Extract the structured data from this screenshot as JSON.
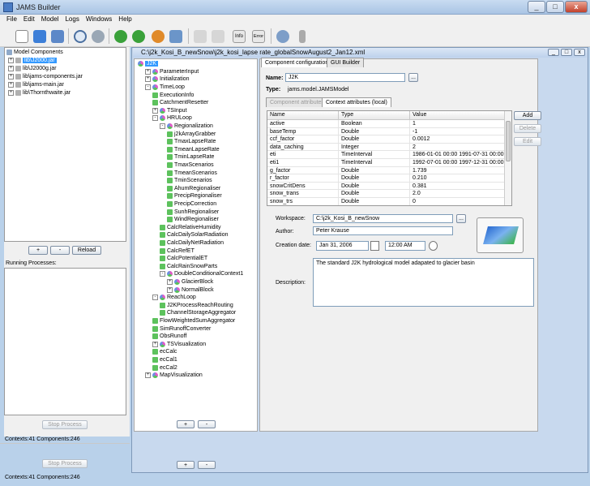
{
  "window": {
    "title": "JAMS Builder",
    "min": "_",
    "max": "□",
    "close": "x"
  },
  "menu": [
    "File",
    "Edit",
    "Model",
    "Logs",
    "Windows",
    "Help"
  ],
  "toolbar": {
    "info_label": "Info",
    "error_label": "Error"
  },
  "left": {
    "header": "Model Components",
    "jars": [
      "lib\\J2000.jar",
      "lib\\J2000g.jar",
      "lib\\jams-components.jar",
      "lib\\jams-main.jar",
      "lib\\Thornthwaite.jar"
    ],
    "add": "+",
    "remove": "-",
    "reload": "Reload",
    "running_header": "Running Processes:",
    "stop_label": "Stop Process",
    "status": "Contexts:41 Components:246"
  },
  "bottom": {
    "stop_label": "Stop Process",
    "status": "Contexts:41 Components:246"
  },
  "internal": {
    "title": "C:\\j2k_Kosi_B_newSnow\\j2k_kosi_lapse rate_globalSnowAugust2_Jan12.xml",
    "tree": [
      {
        "label": "J2K",
        "level": 0,
        "exp": "",
        "icon": "ctx"
      },
      {
        "label": "ParameterInput",
        "level": 1,
        "exp": "+",
        "icon": "ctx"
      },
      {
        "label": "Initialization",
        "level": 1,
        "exp": "+",
        "icon": "ctx"
      },
      {
        "label": "TimeLoop",
        "level": 1,
        "exp": "-",
        "icon": "ctx"
      },
      {
        "label": "ExecutionInfo",
        "level": 2,
        "exp": "",
        "icon": "comp"
      },
      {
        "label": "CatchmentResetter",
        "level": 2,
        "exp": "",
        "icon": "comp"
      },
      {
        "label": "TSInput",
        "level": 2,
        "exp": "+",
        "icon": "ctx"
      },
      {
        "label": "HRULoop",
        "level": 2,
        "exp": "-",
        "icon": "ctx"
      },
      {
        "label": "Regionalization",
        "level": 3,
        "exp": "-",
        "icon": "ctx"
      },
      {
        "label": "j2kArrayGrabber",
        "level": 4,
        "exp": "",
        "icon": "comp"
      },
      {
        "label": "TmaxLapseRate",
        "level": 4,
        "exp": "",
        "icon": "comp"
      },
      {
        "label": "TmeanLapseRate",
        "level": 4,
        "exp": "",
        "icon": "comp"
      },
      {
        "label": "TminLapseRate",
        "level": 4,
        "exp": "",
        "icon": "comp"
      },
      {
        "label": "TmaxScenarios",
        "level": 4,
        "exp": "",
        "icon": "comp"
      },
      {
        "label": "TmeanScenarios",
        "level": 4,
        "exp": "",
        "icon": "comp"
      },
      {
        "label": "TminScenarios",
        "level": 4,
        "exp": "",
        "icon": "comp"
      },
      {
        "label": "AhumRegionaliser",
        "level": 4,
        "exp": "",
        "icon": "comp"
      },
      {
        "label": "PrecipRegionaliser",
        "level": 4,
        "exp": "",
        "icon": "comp"
      },
      {
        "label": "PrecipCorrection",
        "level": 4,
        "exp": "",
        "icon": "comp"
      },
      {
        "label": "SunhRegionaliser",
        "level": 4,
        "exp": "",
        "icon": "comp"
      },
      {
        "label": "WindRegionaliser",
        "level": 4,
        "exp": "",
        "icon": "comp"
      },
      {
        "label": "CalcRelativeHumidity",
        "level": 3,
        "exp": "",
        "icon": "comp"
      },
      {
        "label": "CalcDailySolarRadiation",
        "level": 3,
        "exp": "",
        "icon": "comp"
      },
      {
        "label": "CalcDailyNetRadiation",
        "level": 3,
        "exp": "",
        "icon": "comp"
      },
      {
        "label": "CalcRefET",
        "level": 3,
        "exp": "",
        "icon": "comp"
      },
      {
        "label": "CalcPotentialET",
        "level": 3,
        "exp": "",
        "icon": "comp"
      },
      {
        "label": "CalcRainSnowParts",
        "level": 3,
        "exp": "",
        "icon": "comp"
      },
      {
        "label": "DoubleConditionalContext1",
        "level": 3,
        "exp": "-",
        "icon": "ctx"
      },
      {
        "label": "GlacierBlock",
        "level": 4,
        "exp": "+",
        "icon": "ctx"
      },
      {
        "label": "NormalBlock",
        "level": 4,
        "exp": "+",
        "icon": "ctx"
      },
      {
        "label": "ReachLoop",
        "level": 2,
        "exp": "-",
        "icon": "ctx"
      },
      {
        "label": "J2KProcessReachRouting",
        "level": 3,
        "exp": "",
        "icon": "comp"
      },
      {
        "label": "ChannelStorageAggregator",
        "level": 3,
        "exp": "",
        "icon": "comp"
      },
      {
        "label": "FlowWeightedSumAggregator",
        "level": 2,
        "exp": "",
        "icon": "comp"
      },
      {
        "label": "SimRunoffConverter",
        "level": 2,
        "exp": "",
        "icon": "comp"
      },
      {
        "label": "ObsRunoff",
        "level": 2,
        "exp": "",
        "icon": "comp"
      },
      {
        "label": "TSVisualization",
        "level": 2,
        "exp": "+",
        "icon": "ctx"
      },
      {
        "label": "ecCalc",
        "level": 2,
        "exp": "",
        "icon": "comp"
      },
      {
        "label": "ecCal1",
        "level": 2,
        "exp": "",
        "icon": "comp"
      },
      {
        "label": "ecCal2",
        "level": 2,
        "exp": "",
        "icon": "comp"
      },
      {
        "label": "MapVisualization",
        "level": 1,
        "exp": "+",
        "icon": "ctx"
      }
    ],
    "tree_add": "+",
    "tree_remove": "-",
    "tabs": [
      "Component configuration",
      "GUI Builder"
    ],
    "name_label": "Name:",
    "name_value": "J2K",
    "name_btn": "...",
    "type_label": "Type:",
    "type_value": "jams.model.JAMSModel",
    "subtabs": [
      "Component attributes",
      "Context attributes (local)"
    ],
    "table_headers": [
      "Name",
      "Type",
      "Value"
    ],
    "rows": [
      [
        "active",
        "Boolean",
        "1"
      ],
      [
        "baseTemp",
        "Double",
        "-1"
      ],
      [
        "ccf_factor",
        "Double",
        "0.0012"
      ],
      [
        "data_caching",
        "Integer",
        "2"
      ],
      [
        "eti",
        "TimeInterval",
        "1986-01-01 00:00 1991-07-31 00:00..."
      ],
      [
        "eti1",
        "TimeInterval",
        "1992-07-01 00:00 1997-12-31 00:00..."
      ],
      [
        "g_factor",
        "Double",
        "1.739"
      ],
      [
        "r_factor",
        "Double",
        "0.210"
      ],
      [
        "snowCritDens",
        "Double",
        "0.381"
      ],
      [
        "snow_trans",
        "Double",
        "2.0"
      ],
      [
        "snow_trs",
        "Double",
        "0"
      ]
    ],
    "add_btn": "Add",
    "delete_btn": "Delete",
    "edit_btn": "Edit",
    "workspace_label": "Workspace:",
    "workspace_value": "C:\\j2k_Kosi_B_newSnow",
    "workspace_btn": "...",
    "author_label": "Author:",
    "author_value": "Peter Krause",
    "date_label": "Creation date:",
    "date_value": "Jan 31, 2006",
    "time_value": "12:00 AM",
    "desc_label": "Description:",
    "desc_value": "The standard J2K hydrological model adapated to glacier basin"
  }
}
